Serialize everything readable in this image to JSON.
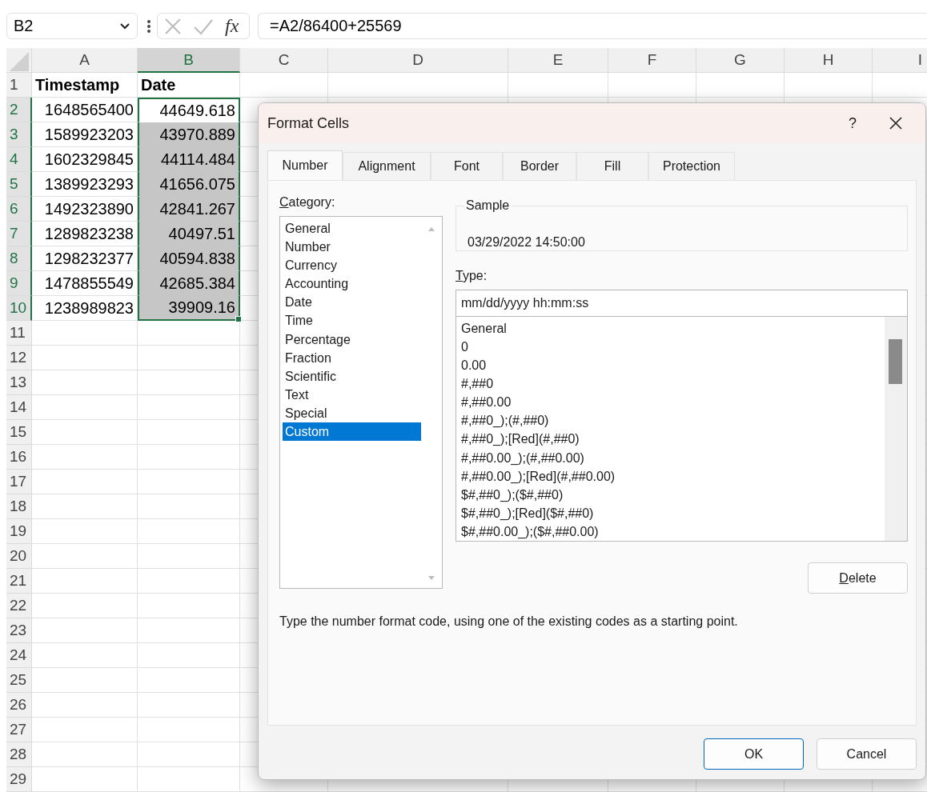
{
  "formula_bar": {
    "name_box": "B2",
    "function_label": "fx",
    "formula": "=A2/86400+25569"
  },
  "sheet": {
    "columns": [
      {
        "label": "A",
        "selected": false
      },
      {
        "label": "B",
        "selected": true
      },
      {
        "label": "C",
        "selected": false
      },
      {
        "label": "D",
        "selected": false
      },
      {
        "label": "E",
        "selected": false
      },
      {
        "label": "F",
        "selected": false
      },
      {
        "label": "G",
        "selected": false
      },
      {
        "label": "H",
        "selected": false
      },
      {
        "label": "I",
        "selected": false
      }
    ],
    "rows": [
      {
        "label": "1",
        "selected": false,
        "active": false,
        "kind": "header",
        "cells": [
          "Timestamp",
          "Date"
        ]
      },
      {
        "label": "2",
        "selected": true,
        "active": true,
        "kind": "data",
        "cells": [
          "1648565400",
          "44649.618"
        ]
      },
      {
        "label": "3",
        "selected": true,
        "active": false,
        "kind": "data",
        "cells": [
          "1589923203",
          "43970.889"
        ]
      },
      {
        "label": "4",
        "selected": true,
        "active": false,
        "kind": "data",
        "cells": [
          "1602329845",
          "44114.484"
        ]
      },
      {
        "label": "5",
        "selected": true,
        "active": false,
        "kind": "data",
        "cells": [
          "1389923293",
          "41656.075"
        ]
      },
      {
        "label": "6",
        "selected": true,
        "active": false,
        "kind": "data",
        "cells": [
          "1492323890",
          "42841.267"
        ]
      },
      {
        "label": "7",
        "selected": true,
        "active": false,
        "kind": "data",
        "cells": [
          "1289823238",
          "40497.51"
        ]
      },
      {
        "label": "8",
        "selected": true,
        "active": false,
        "kind": "data",
        "cells": [
          "1298232377",
          "40594.838"
        ]
      },
      {
        "label": "9",
        "selected": true,
        "active": false,
        "kind": "data",
        "cells": [
          "1478855549",
          "42685.384"
        ]
      },
      {
        "label": "10",
        "selected": true,
        "active": false,
        "kind": "data",
        "cells": [
          "1238989823",
          "39909.16"
        ]
      },
      {
        "label": "11",
        "selected": false,
        "active": false,
        "kind": "data"
      },
      {
        "label": "12",
        "selected": false,
        "active": false,
        "kind": "data"
      },
      {
        "label": "13",
        "selected": false,
        "active": false,
        "kind": "data"
      },
      {
        "label": "14",
        "selected": false,
        "active": false,
        "kind": "data"
      },
      {
        "label": "15",
        "selected": false,
        "active": false,
        "kind": "data"
      },
      {
        "label": "16",
        "selected": false,
        "active": false,
        "kind": "data"
      },
      {
        "label": "17",
        "selected": false,
        "active": false,
        "kind": "data"
      },
      {
        "label": "18",
        "selected": false,
        "active": false,
        "kind": "data"
      },
      {
        "label": "19",
        "selected": false,
        "active": false,
        "kind": "data"
      },
      {
        "label": "20",
        "selected": false,
        "active": false,
        "kind": "data"
      },
      {
        "label": "21",
        "selected": false,
        "active": false,
        "kind": "data"
      },
      {
        "label": "22",
        "selected": false,
        "active": false,
        "kind": "data"
      },
      {
        "label": "23",
        "selected": false,
        "active": false,
        "kind": "data"
      },
      {
        "label": "24",
        "selected": false,
        "active": false,
        "kind": "data"
      },
      {
        "label": "25",
        "selected": false,
        "active": false,
        "kind": "data"
      },
      {
        "label": "26",
        "selected": false,
        "active": false,
        "kind": "data"
      },
      {
        "label": "27",
        "selected": false,
        "active": false,
        "kind": "data"
      },
      {
        "label": "28",
        "selected": false,
        "active": false,
        "kind": "data"
      },
      {
        "label": "29",
        "selected": false,
        "active": false,
        "kind": "data"
      }
    ]
  },
  "dialog": {
    "title": "Format Cells",
    "help": "?",
    "tabs": [
      {
        "label": "Number",
        "selected": true
      },
      {
        "label": "Alignment",
        "selected": false
      },
      {
        "label": "Font",
        "selected": false
      },
      {
        "label": "Border",
        "selected": false
      },
      {
        "label": "Fill",
        "selected": false
      },
      {
        "label": "Protection",
        "selected": false
      }
    ],
    "category_label": "Category:",
    "categories": [
      {
        "label": "General",
        "selected": false
      },
      {
        "label": "Number",
        "selected": false
      },
      {
        "label": "Currency",
        "selected": false
      },
      {
        "label": "Accounting",
        "selected": false
      },
      {
        "label": "Date",
        "selected": false
      },
      {
        "label": "Time",
        "selected": false
      },
      {
        "label": "Percentage",
        "selected": false
      },
      {
        "label": "Fraction",
        "selected": false
      },
      {
        "label": "Scientific",
        "selected": false
      },
      {
        "label": "Text",
        "selected": false
      },
      {
        "label": "Special",
        "selected": false
      },
      {
        "label": "Custom",
        "selected": true
      }
    ],
    "sample_label": "Sample",
    "sample_value": "03/29/2022 14:50:00",
    "type_label": "Type:",
    "type_value": "mm/dd/yyyy hh:mm:ss",
    "types": [
      {
        "label": "General",
        "selected": false
      },
      {
        "label": "0",
        "selected": false
      },
      {
        "label": "0.00",
        "selected": false
      },
      {
        "label": "#,##0",
        "selected": false
      },
      {
        "label": "#,##0.00",
        "selected": false
      },
      {
        "label": "#,##0_);(#,##0)",
        "selected": false
      },
      {
        "label": "#,##0_);[Red](#,##0)",
        "selected": false
      },
      {
        "label": "#,##0.00_);(#,##0.00)",
        "selected": false
      },
      {
        "label": "#,##0.00_);[Red](#,##0.00)",
        "selected": false
      },
      {
        "label": "$#,##0_);($#,##0)",
        "selected": false
      },
      {
        "label": "$#,##0_);[Red]($#,##0)",
        "selected": false
      },
      {
        "label": "$#,##0.00_);($#,##0.00)",
        "selected": false
      }
    ],
    "delete_button": "Delete",
    "description": "Type the number format code, using one of the existing codes as a starting point.",
    "ok_button": "OK",
    "cancel_button": "Cancel"
  }
}
